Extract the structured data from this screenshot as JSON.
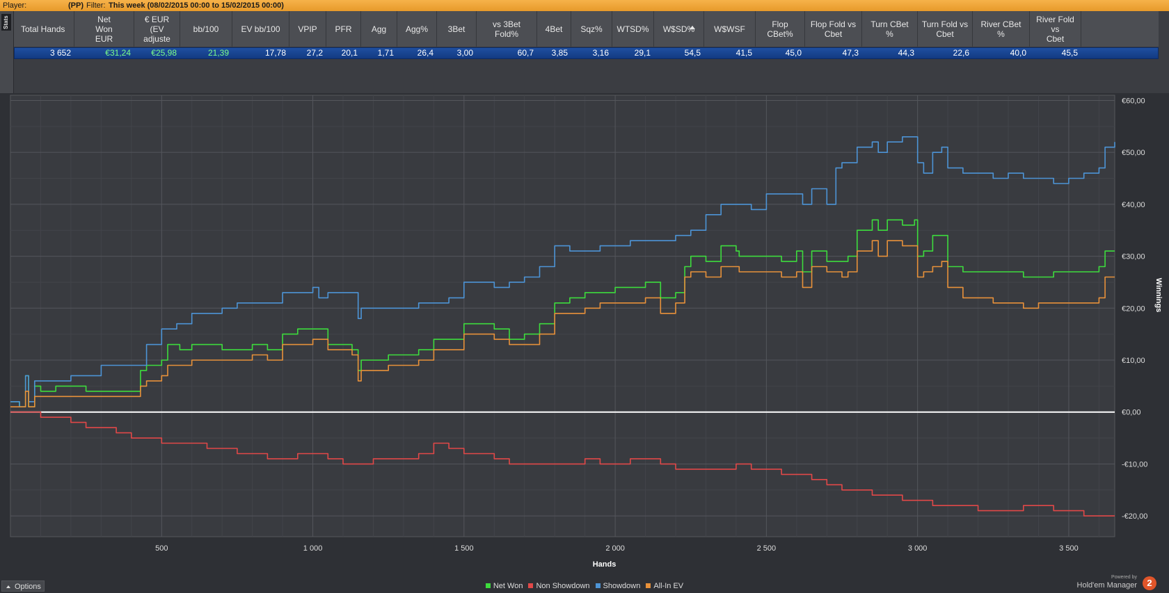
{
  "topbar": {
    "player_label": "Player:",
    "player_value": "(PP)",
    "filter_label": "Filter:",
    "filter_value": "This week (08/02/2015 00:00 to 15/02/2015 00:00)"
  },
  "side_tab": "Stats",
  "columns": [
    {
      "label": "Total Hands",
      "value": "3 652"
    },
    {
      "label": "Net\nWon\nEUR",
      "value": "€31,24",
      "color": "#7dff8a"
    },
    {
      "label": "€ EUR\n(EV\nadjuste",
      "value": "€25,98",
      "color": "#7dff8a"
    },
    {
      "label": "bb/100",
      "value": "21,39",
      "color": "#7dff8a"
    },
    {
      "label": "EV bb/100",
      "value": "17,78"
    },
    {
      "label": "VPIP",
      "value": "27,2"
    },
    {
      "label": "PFR",
      "value": "20,1"
    },
    {
      "label": "Agg",
      "value": "1,71"
    },
    {
      "label": "Agg%",
      "value": "26,4"
    },
    {
      "label": "3Bet",
      "value": "3,00"
    },
    {
      "label": "vs 3Bet\nFold%",
      "value": "60,7"
    },
    {
      "label": "4Bet",
      "value": "3,85"
    },
    {
      "label": "Sqz%",
      "value": "3,16"
    },
    {
      "label": "WTSD%",
      "value": "29,1"
    },
    {
      "label": "W$SD%",
      "value": "54,5",
      "sorted": true
    },
    {
      "label": "W$WSF",
      "value": "41,5"
    },
    {
      "label": "Flop\nCBet%",
      "value": "45,0"
    },
    {
      "label": "Flop Fold vs\nCbet",
      "value": "47,3"
    },
    {
      "label": "Turn CBet\n%",
      "value": "44,3"
    },
    {
      "label": "Turn Fold vs\nCbet",
      "value": "22,6"
    },
    {
      "label": "River CBet\n%",
      "value": "40,0"
    },
    {
      "label": "River Fold vs\nCbet",
      "value": "45,5"
    }
  ],
  "chart_data": {
    "type": "line",
    "xlabel": "Hands",
    "ylabel": "Winnings",
    "xlim": [
      0,
      3652
    ],
    "ylim": [
      -24,
      61
    ],
    "x_ticks": [
      500,
      1000,
      1500,
      2000,
      2500,
      3000,
      3500
    ],
    "x_tick_labels": [
      "500",
      "1 000",
      "1 500",
      "2 000",
      "2 500",
      "3 000",
      "3 500"
    ],
    "y_ticks": [
      60,
      50,
      40,
      30,
      20,
      10,
      0,
      -10,
      -20
    ],
    "y_tick_labels": [
      "€60,00",
      "€50,00",
      "€40,00",
      "€30,00",
      "€20,00",
      "€10,00",
      "€0,00",
      "-€10,00",
      "-€20,00"
    ],
    "grid": true,
    "legend_position": "bottom",
    "series": [
      {
        "name": "Net Won",
        "color": "#3ddc3d",
        "x": [
          0,
          30,
          50,
          60,
          80,
          100,
          150,
          200,
          250,
          300,
          350,
          420,
          430,
          450,
          500,
          520,
          560,
          600,
          620,
          700,
          750,
          800,
          850,
          900,
          950,
          1000,
          1020,
          1050,
          1100,
          1130,
          1150,
          1160,
          1200,
          1250,
          1300,
          1350,
          1400,
          1450,
          1500,
          1550,
          1600,
          1650,
          1700,
          1750,
          1800,
          1850,
          1900,
          1950,
          2000,
          2050,
          2100,
          2150,
          2200,
          2230,
          2250,
          2300,
          2350,
          2400,
          2410,
          2450,
          2500,
          2550,
          2600,
          2620,
          2650,
          2700,
          2750,
          2770,
          2800,
          2850,
          2870,
          2900,
          2950,
          2990,
          3000,
          3020,
          3050,
          3080,
          3100,
          3150,
          3200,
          3250,
          3300,
          3350,
          3400,
          3450,
          3500,
          3550,
          3600,
          3620,
          3652
        ],
        "values": [
          2,
          1,
          7,
          1,
          5,
          4,
          5,
          5,
          4,
          4,
          4,
          4,
          8,
          9,
          10,
          13,
          12,
          13,
          13,
          12,
          12,
          13,
          12,
          15,
          16,
          16,
          16,
          13,
          13,
          12,
          8,
          10,
          10,
          11,
          11,
          12,
          14,
          14,
          17,
          17,
          16,
          14,
          15,
          17,
          21,
          22,
          23,
          23,
          24,
          24,
          25,
          22,
          23,
          28,
          30,
          29,
          32,
          31,
          30,
          30,
          30,
          29,
          31,
          27,
          31,
          29,
          29,
          30,
          35,
          37,
          35,
          37,
          36,
          37,
          30,
          31,
          34,
          34,
          28,
          27,
          27,
          27,
          27,
          26,
          26,
          27,
          27,
          27,
          28,
          31,
          31
        ]
      },
      {
        "name": "Non Showdown",
        "color": "#e14848",
        "x": [
          0,
          50,
          100,
          150,
          200,
          250,
          300,
          350,
          400,
          450,
          500,
          550,
          600,
          650,
          700,
          750,
          800,
          850,
          900,
          950,
          1000,
          1050,
          1100,
          1150,
          1200,
          1250,
          1300,
          1350,
          1400,
          1450,
          1500,
          1550,
          1600,
          1650,
          1700,
          1750,
          1800,
          1850,
          1900,
          1950,
          2000,
          2050,
          2100,
          2150,
          2200,
          2250,
          2300,
          2350,
          2400,
          2450,
          2500,
          2550,
          2600,
          2650,
          2700,
          2750,
          2800,
          2850,
          2900,
          2950,
          3000,
          3050,
          3100,
          3150,
          3200,
          3250,
          3300,
          3350,
          3400,
          3450,
          3500,
          3550,
          3600,
          3652
        ],
        "values": [
          0,
          0,
          -1,
          -1,
          -2,
          -3,
          -3,
          -4,
          -5,
          -5,
          -6,
          -6,
          -6,
          -7,
          -7,
          -8,
          -8,
          -9,
          -9,
          -8,
          -8,
          -9,
          -10,
          -10,
          -9,
          -9,
          -9,
          -8,
          -6,
          -7,
          -8,
          -8,
          -9,
          -10,
          -10,
          -10,
          -10,
          -10,
          -9,
          -10,
          -10,
          -9,
          -9,
          -10,
          -11,
          -11,
          -11,
          -11,
          -10,
          -11,
          -11,
          -12,
          -12,
          -13,
          -14,
          -15,
          -15,
          -16,
          -16,
          -17,
          -17,
          -18,
          -18,
          -18,
          -19,
          -19,
          -19,
          -18,
          -18,
          -19,
          -19,
          -20,
          -20,
          -20
        ]
      },
      {
        "name": "Showdown",
        "color": "#4d94d6",
        "x": [
          0,
          30,
          50,
          60,
          80,
          100,
          150,
          200,
          300,
          350,
          420,
          430,
          450,
          500,
          550,
          600,
          650,
          700,
          750,
          800,
          850,
          900,
          950,
          1000,
          1020,
          1050,
          1100,
          1130,
          1150,
          1160,
          1200,
          1250,
          1300,
          1350,
          1400,
          1450,
          1500,
          1550,
          1600,
          1650,
          1700,
          1750,
          1800,
          1850,
          1900,
          1950,
          2000,
          2050,
          2100,
          2150,
          2200,
          2250,
          2300,
          2350,
          2400,
          2450,
          2500,
          2550,
          2600,
          2620,
          2650,
          2700,
          2730,
          2750,
          2800,
          2850,
          2870,
          2900,
          2950,
          2990,
          3000,
          3020,
          3050,
          3080,
          3100,
          3150,
          3200,
          3250,
          3300,
          3350,
          3400,
          3450,
          3500,
          3550,
          3600,
          3620,
          3652
        ],
        "values": [
          2,
          1,
          7,
          2,
          6,
          6,
          6,
          7,
          9,
          9,
          9,
          9,
          13,
          16,
          17,
          19,
          19,
          20,
          21,
          21,
          21,
          23,
          23,
          24,
          22,
          23,
          23,
          23,
          18,
          20,
          20,
          20,
          20,
          21,
          21,
          22,
          25,
          25,
          24,
          25,
          26,
          28,
          32,
          31,
          31,
          32,
          32,
          33,
          33,
          33,
          34,
          35,
          38,
          40,
          40,
          39,
          42,
          42,
          42,
          40,
          43,
          40,
          47,
          48,
          51,
          52,
          50,
          52,
          53,
          53,
          48,
          46,
          50,
          51,
          47,
          46,
          46,
          45,
          46,
          45,
          45,
          44,
          45,
          46,
          47,
          51,
          52
        ]
      },
      {
        "name": "All-In EV",
        "color": "#e8913a",
        "x": [
          0,
          30,
          50,
          60,
          80,
          100,
          150,
          200,
          250,
          300,
          350,
          420,
          430,
          450,
          500,
          520,
          560,
          600,
          620,
          700,
          750,
          800,
          850,
          900,
          950,
          1000,
          1020,
          1050,
          1100,
          1130,
          1150,
          1160,
          1200,
          1250,
          1300,
          1350,
          1400,
          1450,
          1500,
          1550,
          1600,
          1650,
          1700,
          1750,
          1800,
          1850,
          1900,
          1950,
          2000,
          2050,
          2100,
          2150,
          2200,
          2230,
          2250,
          2300,
          2350,
          2400,
          2410,
          2450,
          2500,
          2550,
          2600,
          2620,
          2650,
          2700,
          2750,
          2770,
          2800,
          2850,
          2870,
          2900,
          2950,
          2990,
          3000,
          3020,
          3050,
          3080,
          3100,
          3150,
          3200,
          3250,
          3300,
          3350,
          3400,
          3450,
          3500,
          3550,
          3600,
          3620,
          3652
        ],
        "values": [
          1,
          1,
          4,
          1,
          3,
          3,
          3,
          3,
          3,
          3,
          3,
          3,
          5,
          6,
          7,
          9,
          9,
          10,
          10,
          10,
          10,
          11,
          10,
          13,
          13,
          14,
          14,
          12,
          12,
          11,
          6,
          8,
          8,
          9,
          9,
          10,
          12,
          12,
          15,
          15,
          14,
          13,
          13,
          15,
          19,
          19,
          20,
          21,
          21,
          21,
          22,
          19,
          21,
          26,
          27,
          26,
          28,
          28,
          27,
          27,
          27,
          26,
          27,
          24,
          28,
          27,
          26,
          27,
          31,
          33,
          30,
          33,
          32,
          32,
          26,
          27,
          28,
          29,
          24,
          22,
          22,
          21,
          21,
          20,
          21,
          21,
          21,
          21,
          22,
          26,
          26
        ]
      }
    ]
  },
  "bottom": {
    "options_label": "Options",
    "legend": [
      "Net Won",
      "Non Showdown",
      "Showdown",
      "All-In EV"
    ],
    "powered_by": "Powered by",
    "brand": "Hold'em Manager",
    "logo_text": "2"
  }
}
